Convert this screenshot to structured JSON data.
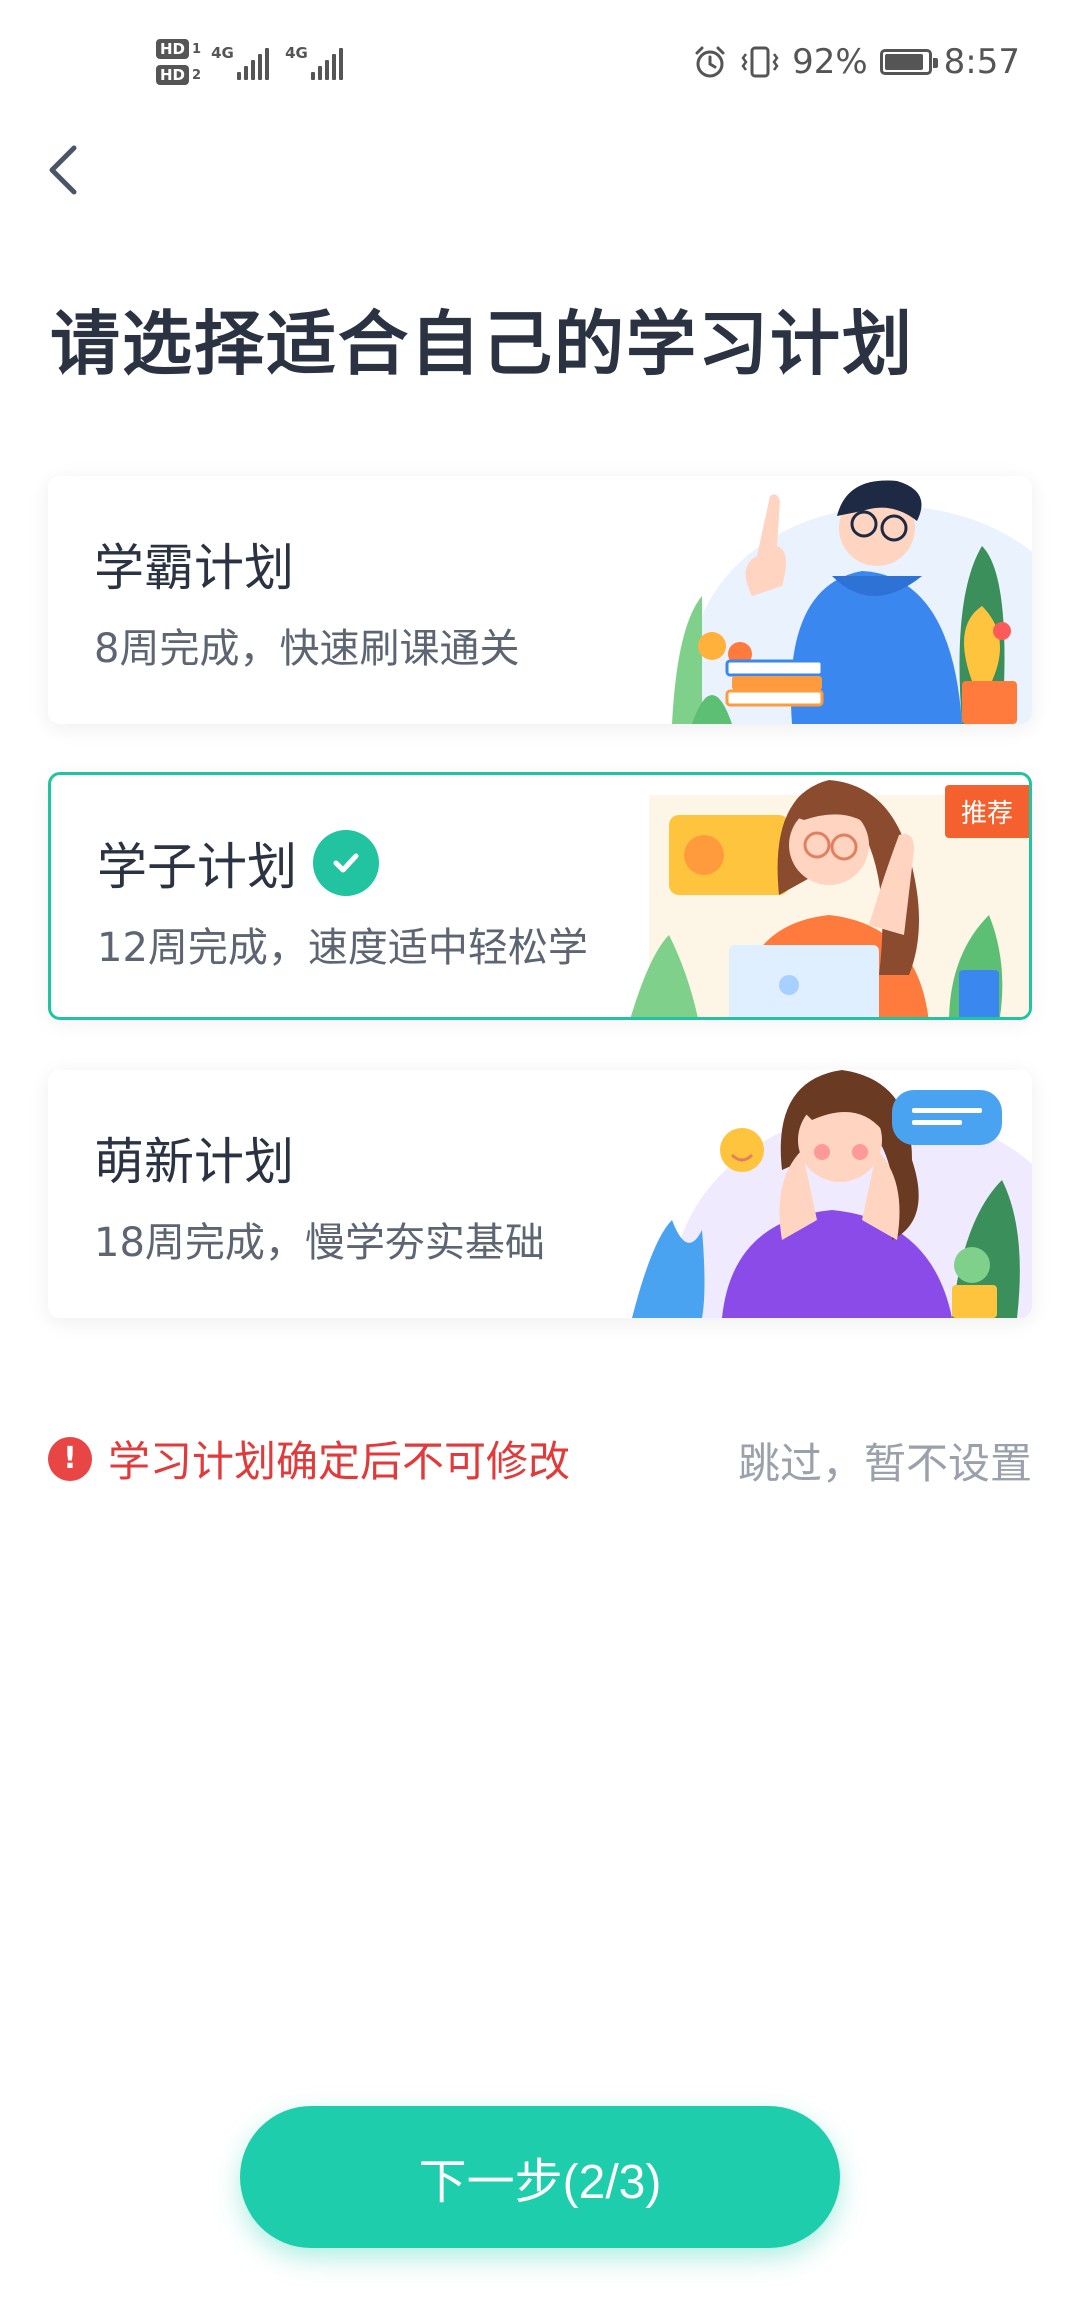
{
  "status_bar": {
    "sim1": "HD",
    "sim1_slot": "1",
    "sim2": "HD",
    "sim2_slot": "2",
    "network1": "4G",
    "network2": "4G",
    "battery_percent": "92%",
    "battery_level": 0.92,
    "time": "8:57"
  },
  "header": {
    "title": "请选择适合自己的学习计划"
  },
  "plans": [
    {
      "name": "学霸计划",
      "desc": "8周完成，快速刷课通关",
      "selected": false
    },
    {
      "name": "学子计划",
      "desc": "12周完成，速度适中轻松学",
      "selected": true,
      "badge": "推荐"
    },
    {
      "name": "萌新计划",
      "desc": "18周完成，慢学夯实基础",
      "selected": false
    }
  ],
  "notice": {
    "warning_text": "学习计划确定后不可修改",
    "skip_text": "跳过，暂不设置"
  },
  "footer": {
    "next_label": "下一步(2/3)"
  },
  "colors": {
    "accent": "#1ecdab",
    "warning": "#e03a3a",
    "badge": "#f5612e"
  }
}
